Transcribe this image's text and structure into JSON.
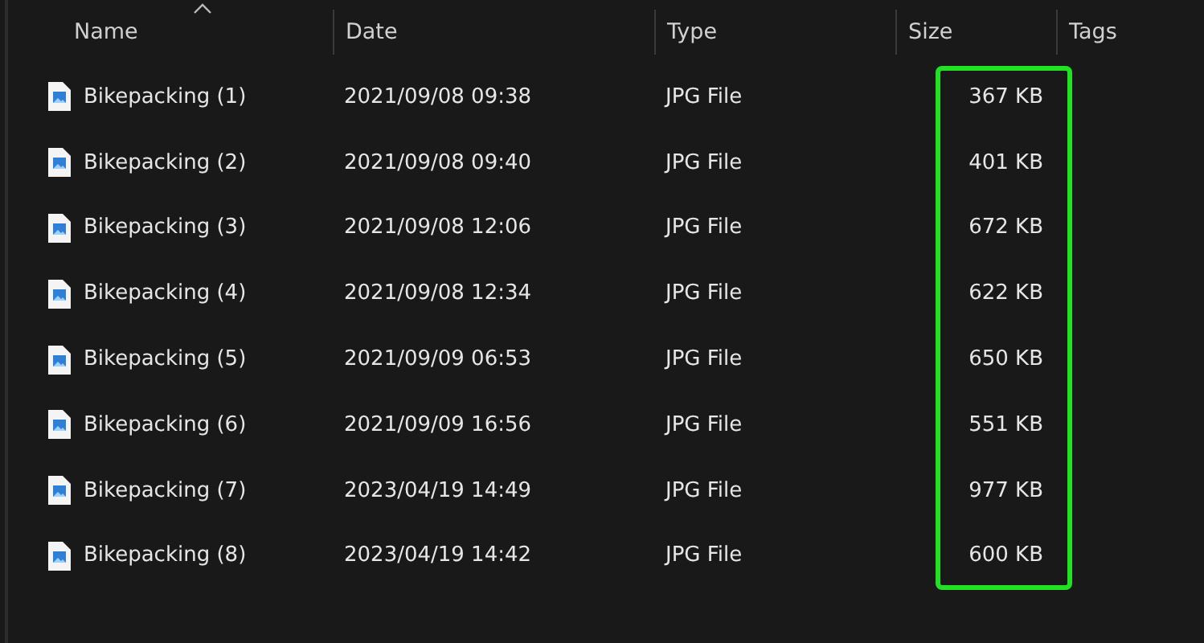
{
  "columns": [
    {
      "label": "Name",
      "sorted": true
    },
    {
      "label": "Date",
      "sorted": false
    },
    {
      "label": "Type",
      "sorted": false
    },
    {
      "label": "Size",
      "sorted": false
    },
    {
      "label": "Tags",
      "sorted": false
    }
  ],
  "rows": [
    {
      "name": "Bikepacking (1)",
      "date": "2021/09/08 09:38",
      "type": "JPG File",
      "size": "367 KB"
    },
    {
      "name": "Bikepacking (2)",
      "date": "2021/09/08 09:40",
      "type": "JPG File",
      "size": "401 KB"
    },
    {
      "name": "Bikepacking (3)",
      "date": "2021/09/08 12:06",
      "type": "JPG File",
      "size": "672 KB"
    },
    {
      "name": "Bikepacking (4)",
      "date": "2021/09/08 12:34",
      "type": "JPG File",
      "size": "622 KB"
    },
    {
      "name": "Bikepacking (5)",
      "date": "2021/09/09 06:53",
      "type": "JPG File",
      "size": "650 KB"
    },
    {
      "name": "Bikepacking (6)",
      "date": "2021/09/09 16:56",
      "type": "JPG File",
      "size": "551 KB"
    },
    {
      "name": "Bikepacking (7)",
      "date": "2023/04/19 14:49",
      "type": "JPG File",
      "size": "977 KB"
    },
    {
      "name": "Bikepacking (8)",
      "date": "2023/04/19 14:42",
      "type": "JPG File",
      "size": "600 KB"
    }
  ],
  "highlight": {
    "color": "#22e022"
  }
}
